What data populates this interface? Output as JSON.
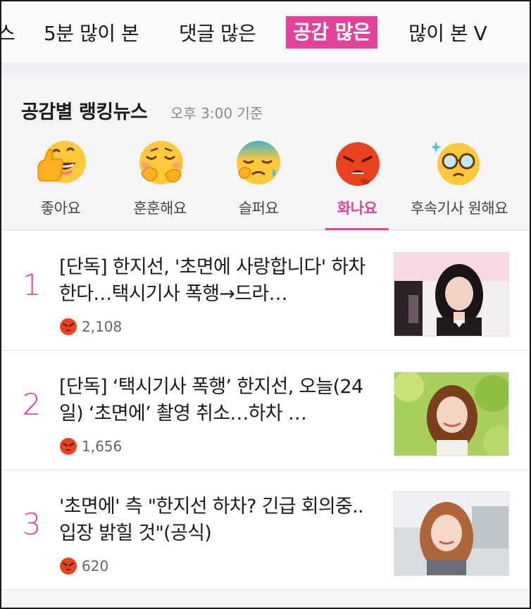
{
  "tabs": [
    {
      "label": "스",
      "active": false
    },
    {
      "label": "5분 많이 본",
      "active": false
    },
    {
      "label": "댓글 많은",
      "active": false
    },
    {
      "label": "공감 많은",
      "active": true
    },
    {
      "label": "많이 본 V",
      "active": false
    }
  ],
  "panel": {
    "title": "공감별 랭킹뉴스",
    "time": "오후 3:00 기준"
  },
  "emotions": [
    {
      "label": "좋아요",
      "icon": "thumbs-up-smile-face-icon",
      "active": false
    },
    {
      "label": "훈훈해요",
      "icon": "warm-blushing-face-icon",
      "active": false
    },
    {
      "label": "슬퍼요",
      "icon": "sad-sweat-face-icon",
      "active": false
    },
    {
      "label": "화나요",
      "icon": "angry-red-face-icon",
      "active": true
    },
    {
      "label": "후속기사 원해요",
      "icon": "glasses-sparkle-face-icon",
      "active": false
    }
  ],
  "articles": [
    {
      "rank": "1",
      "title": "[단독] 한지선, '초면에 사랑합니다' 하차한다…택시기사 폭행→드라…",
      "count": "2,108"
    },
    {
      "rank": "2",
      "title": "[단독] ‘택시기사 폭행’ 한지선, 오늘(24일) ‘초면에’ 촬영 취소…하차 …",
      "count": "1,656"
    },
    {
      "rank": "3",
      "title": "'초면에' 측 \"한지선 하차? 긴급 회의중..입장 밝힐 것\"(공식)",
      "count": "620"
    }
  ],
  "colors": {
    "accent": "#e5409a",
    "angry": "#e8431e",
    "emoji_yellow": "#ffc83d"
  }
}
